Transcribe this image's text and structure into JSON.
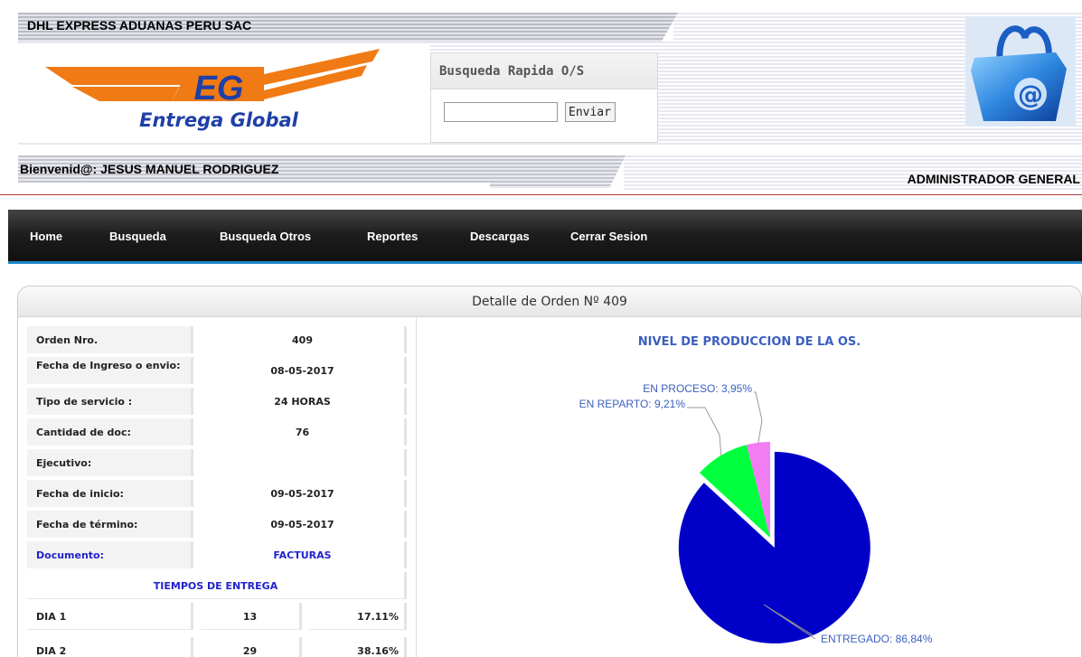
{
  "header": {
    "company": "DHL EXPRESS ADUANAS PERU SAC",
    "logo_letters": "EG",
    "logo_tagline": "Entrega Global",
    "welcome": "Bienvenid@: JESUS MANUEL RODRIGUEZ",
    "role": "ADMINISTRADOR GENERAL",
    "cart_icon_glyph": "@"
  },
  "quick_search": {
    "title": "Busqueda Rapida O/S",
    "input_value": "",
    "button_label": "Enviar"
  },
  "nav": {
    "items": [
      "Home",
      "Busqueda",
      "Busqueda Otros",
      "Reportes",
      "Descargas",
      "Cerrar Sesion"
    ]
  },
  "panel": {
    "title": "Detalle de Orden Nº 409"
  },
  "detail": {
    "rows": [
      {
        "label": "Orden Nro.",
        "value": "409"
      },
      {
        "label": "Fecha de Ingreso o envio:",
        "value": "08-05-2017"
      },
      {
        "label": "Tipo de servicio :",
        "value": "24 HORAS"
      },
      {
        "label": "Cantidad de doc:",
        "value": "76"
      },
      {
        "label": "Ejecutivo:",
        "value": ""
      },
      {
        "label": "Fecha de inicio:",
        "value": "09-05-2017"
      },
      {
        "label": "Fecha de término:",
        "value": "09-05-2017"
      },
      {
        "label": "Documento:",
        "value": "FACTURAS"
      }
    ],
    "section_title": "TIEMPOS DE ENTREGA",
    "tiempos": [
      {
        "label": "DIA 1",
        "count": "13",
        "pct": "17.11%"
      },
      {
        "label": "DIA 2",
        "count": "29",
        "pct": "38.16%"
      }
    ]
  },
  "colors": {
    "entregado": "#0000c8",
    "en_reparto": "#00ff3c",
    "en_proceso": "#f27cf2",
    "chart_label": "#3b5fbf",
    "nav_accent": "#1e88c8"
  },
  "chart_data": {
    "type": "pie",
    "title": "NIVEL DE PRODUCCION DE LA OS.",
    "slices": [
      {
        "name": "ENTREGADO",
        "value": 86.84,
        "label": "ENTREGADO: 86,84%"
      },
      {
        "name": "EN REPARTO",
        "value": 9.21,
        "label": "EN REPARTO: 9,21%"
      },
      {
        "name": "EN PROCESO",
        "value": 3.95,
        "label": "EN PROCESO: 3,95%"
      }
    ]
  }
}
